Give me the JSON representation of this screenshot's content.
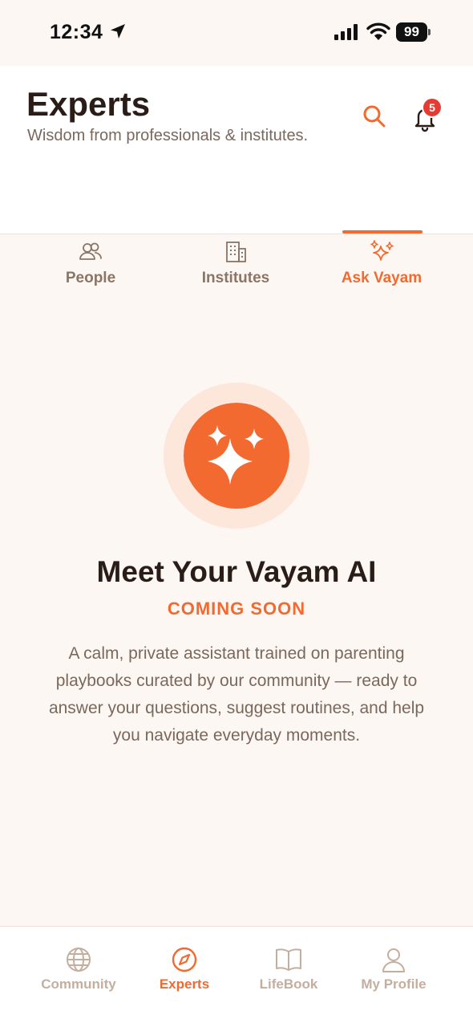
{
  "status_bar": {
    "time": "12:34",
    "battery": "99"
  },
  "header": {
    "title": "Experts",
    "subtitle": "Wisdom from professionals & institutes.",
    "notification_count": "5"
  },
  "tabs": [
    {
      "label": "People",
      "icon": "people-icon",
      "active": false
    },
    {
      "label": "Institutes",
      "icon": "building-icon",
      "active": false
    },
    {
      "label": "Ask Vayam",
      "icon": "sparkles-icon",
      "active": true
    }
  ],
  "hero": {
    "icon": "sparkles-icon",
    "title": "Meet Your Vayam AI",
    "badge": "COMING SOON",
    "description": "A calm, private assistant trained on parenting playbooks curated by our community — ready to answer your questions, suggest routines, and help you navigate everyday moments."
  },
  "bottom_nav": [
    {
      "label": "Community",
      "icon": "globe-icon",
      "active": false
    },
    {
      "label": "Experts",
      "icon": "compass-icon",
      "active": true
    },
    {
      "label": "LifeBook",
      "icon": "book-icon",
      "active": false
    },
    {
      "label": "My Profile",
      "icon": "profile-icon",
      "active": false
    }
  ],
  "colors": {
    "accent": "#f26a30",
    "background": "#fdf7f3",
    "text_primary": "#2a1d17",
    "text_secondary": "#7a685d",
    "badge": "#e53b33"
  }
}
